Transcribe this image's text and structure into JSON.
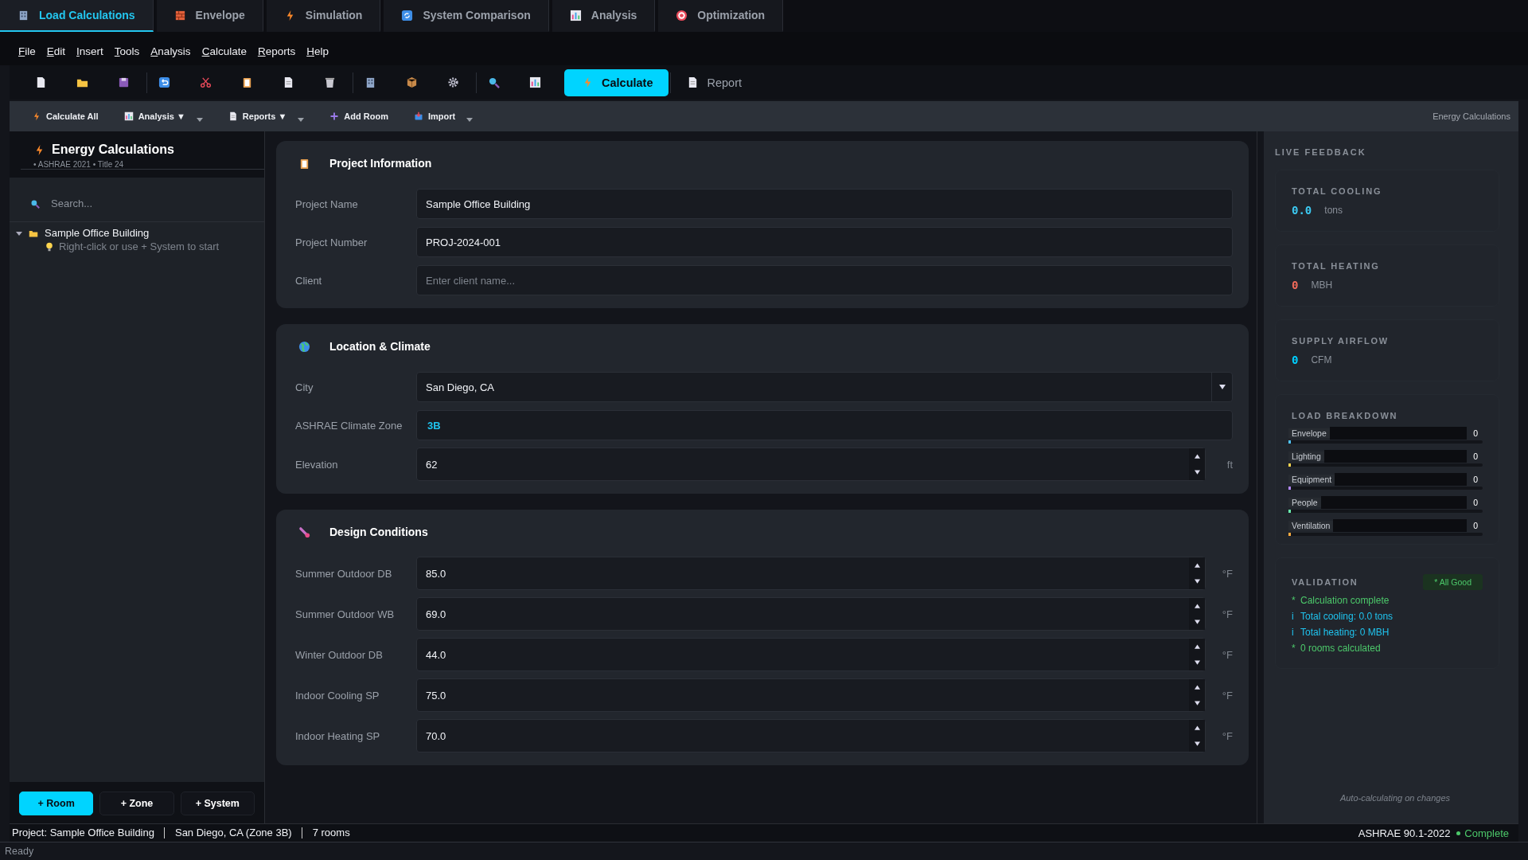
{
  "tabs": [
    {
      "label": "Load Calculations",
      "selected": true
    },
    {
      "label": "Envelope",
      "selected": false
    },
    {
      "label": "Simulation",
      "selected": false
    },
    {
      "label": "System Comparison",
      "selected": false
    },
    {
      "label": "Analysis",
      "selected": false
    },
    {
      "label": "Optimization",
      "selected": false
    }
  ],
  "menu": [
    "File",
    "Edit",
    "Insert",
    "Tools",
    "Analysis",
    "Calculate",
    "Reports",
    "Help"
  ],
  "toolbar": {
    "calculate_button": "Calculate",
    "report_button": "Report"
  },
  "action_bar": {
    "items": [
      {
        "label": "Calculate All",
        "dropdown": false
      },
      {
        "label": "Analysis ▼",
        "dropdown": true
      },
      {
        "label": "Reports ▼",
        "dropdown": true
      },
      {
        "label": "Add Room",
        "dropdown": false
      },
      {
        "label": "Import",
        "dropdown": true
      }
    ],
    "context": "Energy Calculations"
  },
  "sidebar": {
    "title": "Energy Calculations",
    "subtitle": "• ASHRAE 2021 • Title 24",
    "search": {
      "placeholder": "Search..."
    },
    "tree": [
      {
        "label": "Sample Office Building",
        "expanded": true,
        "children": [
          {
            "label": "Right-click or use + System to start"
          }
        ]
      }
    ],
    "buttons": [
      {
        "label": "+ Room",
        "kind": "primary"
      },
      {
        "label": "+ Zone",
        "kind": "plain"
      },
      {
        "label": "+ System",
        "kind": "plain"
      }
    ]
  },
  "sections": [
    {
      "title": "Project Information",
      "fields": [
        {
          "label": "Project Name",
          "kind": "text",
          "value": "Sample Office Building"
        },
        {
          "label": "Project Number",
          "kind": "text",
          "value": "PROJ-2024-001"
        },
        {
          "label": "Client",
          "kind": "text",
          "placeholder": "Enter client name..."
        }
      ]
    },
    {
      "title": "Location & Climate",
      "fields": [
        {
          "label": "City",
          "kind": "select",
          "value": "San Diego, CA"
        },
        {
          "label": "ASHRAE Climate Zone",
          "kind": "readonly",
          "value": "3B"
        },
        {
          "label": "Elevation",
          "kind": "number",
          "value": "62",
          "unit": "ft"
        }
      ]
    },
    {
      "title": "Design Conditions",
      "fields": [
        {
          "label": "Summer Outdoor DB",
          "kind": "number",
          "value": "85.0",
          "unit": "°F"
        },
        {
          "label": "Summer Outdoor WB",
          "kind": "number",
          "value": "69.0",
          "unit": "°F"
        },
        {
          "label": "Winter Outdoor DB",
          "kind": "number",
          "value": "44.0",
          "unit": "°F"
        },
        {
          "label": "Indoor Cooling SP",
          "kind": "number",
          "value": "75.0",
          "unit": "°F"
        },
        {
          "label": "Indoor Heating SP",
          "kind": "number",
          "value": "70.0",
          "unit": "°F"
        }
      ]
    }
  ],
  "feedback": {
    "title": "LIVE FEEDBACK",
    "metrics": [
      {
        "label": "TOTAL COOLING",
        "value": "0.0",
        "unit": "tons",
        "color": "#3cc8f0"
      },
      {
        "label": "TOTAL HEATING",
        "value": "0",
        "unit": "MBH",
        "color": "#f06a5a"
      },
      {
        "label": "SUPPLY AIRFLOW",
        "value": "0",
        "unit": "CFM",
        "color": "#00cfff"
      }
    ],
    "breakdown": {
      "title": "LOAD BREAKDOWN",
      "items": [
        {
          "label": "Envelope",
          "value": "0",
          "level": 0,
          "color": "#4fc3f7"
        },
        {
          "label": "Lighting",
          "value": "0",
          "level": 0,
          "color": "#ffd54f"
        },
        {
          "label": "Equipment",
          "value": "0",
          "level": 0,
          "color": "#b388ff"
        },
        {
          "label": "People",
          "value": "0",
          "level": 0,
          "color": "#69f0ae"
        },
        {
          "label": "Ventilation",
          "value": "0",
          "level": 0,
          "color": "#ffab40"
        }
      ]
    },
    "validation": {
      "title": "VALIDATION",
      "badge": "* All Good",
      "items": [
        {
          "mark": "*",
          "text": "Calculation complete",
          "kind": "ok"
        },
        {
          "mark": "i",
          "text": "Total cooling: 0.0 tons",
          "kind": "info"
        },
        {
          "mark": "i",
          "text": "Total heating: 0 MBH",
          "kind": "info"
        },
        {
          "mark": "*",
          "text": "0 rooms calculated",
          "kind": "ok"
        }
      ]
    },
    "footnote": "Auto-calculating on changes"
  },
  "status_bar": {
    "segments": [
      "Project: Sample Office Building",
      "San Diego, CA (Zone 3B)",
      "7 rooms"
    ],
    "standard": "ASHRAE 90.1-2022",
    "state": "Complete"
  },
  "footer": "Ready"
}
